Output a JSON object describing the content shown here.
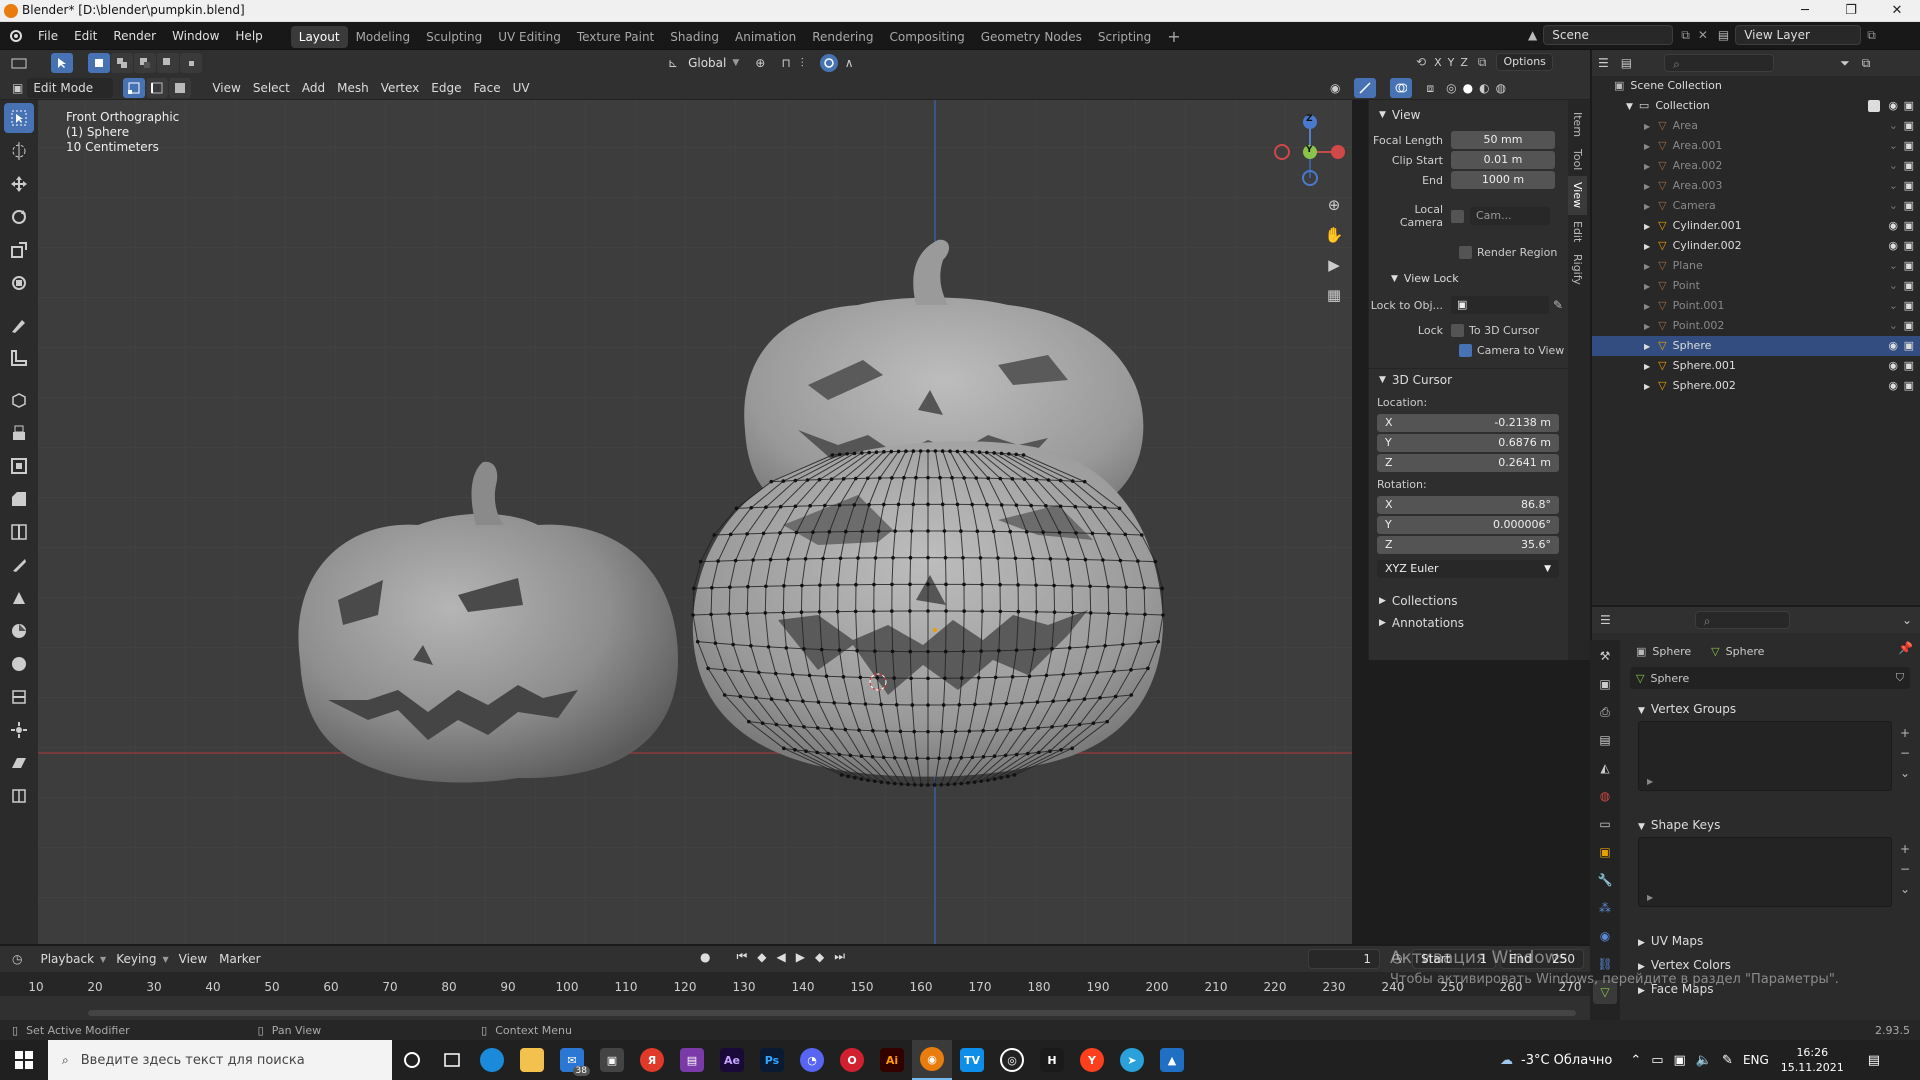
{
  "window": {
    "title": "Blender* [D:\\blender\\pumpkin.blend]"
  },
  "menu": [
    "File",
    "Edit",
    "Render",
    "Window",
    "Help"
  ],
  "workspaces": [
    "Layout",
    "Modeling",
    "Sculpting",
    "UV Editing",
    "Texture Paint",
    "Shading",
    "Animation",
    "Rendering",
    "Compositing",
    "Geometry Nodes",
    "Scripting"
  ],
  "scene": {
    "name": "Scene",
    "view_layer": "View Layer"
  },
  "viewport_header": {
    "mode": "Edit Mode",
    "menus": [
      "View",
      "Select",
      "Add",
      "Mesh",
      "Vertex",
      "Edge",
      "Face",
      "UV"
    ],
    "transform_orientation": "Global",
    "options": "Options"
  },
  "viewport_overlay": {
    "view_name": "Front Orthographic",
    "object": "(1) Sphere",
    "scale": "10 Centimeters"
  },
  "gizmo": {
    "z": "Z",
    "y": "Y"
  },
  "npanel": {
    "tabs": [
      "Item",
      "Tool",
      "View",
      "Edit",
      "Rigify"
    ],
    "view": {
      "title": "View",
      "focal_length_label": "Focal Length",
      "focal_length": "50 mm",
      "clip_start_label": "Clip Start",
      "clip_start": "0.01 m",
      "end_label": "End",
      "end": "1000 m",
      "local_camera_label": "Local Camera",
      "local_camera": "Cam...",
      "render_region": "Render Region",
      "view_lock": "View Lock",
      "lock_to_obj": "Lock to Obj...",
      "lock_label": "Lock",
      "to_3d_cursor": "To 3D Cursor",
      "camera_to_view": "Camera to View"
    },
    "cursor": {
      "title": "3D Cursor",
      "location_label": "Location:",
      "loc": [
        {
          "axis": "X",
          "value": "-0.2138 m"
        },
        {
          "axis": "Y",
          "value": "0.6876 m"
        },
        {
          "axis": "Z",
          "value": "0.2641 m"
        }
      ],
      "rotation_label": "Rotation:",
      "rot": [
        {
          "axis": "X",
          "value": "86.8°"
        },
        {
          "axis": "Y",
          "value": "0.000006°"
        },
        {
          "axis": "Z",
          "value": "35.6°"
        }
      ],
      "mode": "XYZ Euler"
    },
    "collections": "Collections",
    "annotations": "Annotations"
  },
  "outliner": {
    "root": "Scene Collection",
    "collection": "Collection",
    "items": [
      {
        "name": "Area",
        "dim": true,
        "sel": false
      },
      {
        "name": "Area.001",
        "dim": true,
        "sel": false
      },
      {
        "name": "Area.002",
        "dim": true,
        "sel": false
      },
      {
        "name": "Area.003",
        "dim": true,
        "sel": false
      },
      {
        "name": "Camera",
        "dim": true,
        "sel": false
      },
      {
        "name": "Cylinder.001",
        "dim": false,
        "sel": false
      },
      {
        "name": "Cylinder.002",
        "dim": false,
        "sel": false
      },
      {
        "name": "Plane",
        "dim": true,
        "sel": false
      },
      {
        "name": "Point",
        "dim": true,
        "sel": false
      },
      {
        "name": "Point.001",
        "dim": true,
        "sel": false
      },
      {
        "name": "Point.002",
        "dim": true,
        "sel": false
      },
      {
        "name": "Sphere",
        "dim": false,
        "sel": true
      },
      {
        "name": "Sphere.001",
        "dim": false,
        "sel": false
      },
      {
        "name": "Sphere.002",
        "dim": false,
        "sel": false
      }
    ]
  },
  "properties": {
    "object": "Sphere",
    "mesh": "Sphere",
    "data_name": "Sphere",
    "sections": [
      "Vertex Groups",
      "Shape Keys",
      "UV Maps",
      "Vertex Colors",
      "Face Maps"
    ]
  },
  "timeline": {
    "menus": [
      "Playback",
      "Keying",
      "View",
      "Marker"
    ],
    "current_frame": "1",
    "start_label": "Start",
    "start": "1",
    "end_label": "End",
    "end": "250",
    "ticks": [
      "10",
      "20",
      "30",
      "40",
      "50",
      "60",
      "70",
      "80",
      "90",
      "100",
      "110",
      "120",
      "130",
      "140",
      "150",
      "160",
      "170",
      "180",
      "190",
      "200",
      "210",
      "220",
      "230",
      "240",
      "250",
      "260",
      "270"
    ]
  },
  "activation": {
    "line1": "Активация Windows",
    "line2": "Чтобы активировать Windows, перейдите в раздел \"Параметры\"."
  },
  "status": {
    "left": "Set Active Modifier",
    "mid": "Pan View",
    "right": "Context Menu",
    "version": "2.93.5"
  },
  "taskbar": {
    "search_placeholder": "Введите здесь текст для поиска",
    "mail_badge": "38",
    "weather": "-3°C  Облачно",
    "lang": "ENG",
    "time": "16:26",
    "date": "15.11.2021"
  },
  "colors": {
    "accent": "#4772b3",
    "selected_row": "#334d80",
    "blender_orange": "#e87d0d"
  }
}
